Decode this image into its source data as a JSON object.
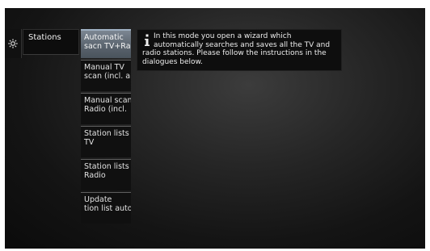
{
  "menu": {
    "category": "Stations"
  },
  "submenu": {
    "items": [
      {
        "label_line1": "Automatic",
        "label_line2": "sacn TV+Rad"
      },
      {
        "label_line1": "Manual TV",
        "label_line2": "scan (incl. an"
      },
      {
        "label_line1": "Manual scan",
        "label_line2": "Radio (incl."
      },
      {
        "label_line1": "Station lists",
        "label_line2": "TV"
      },
      {
        "label_line1": "Station lists",
        "label_line2": "Radio"
      },
      {
        "label_line1": "Update",
        "label_line2": "tion list auto"
      }
    ]
  },
  "info": {
    "text": "In this mode you open a wizard which automatically searches and saves all the TV and radio stations. Please follow the instructions in the dialogues below."
  },
  "icons": {
    "settings": "gear-icon",
    "info": "info-icon"
  },
  "colors": {
    "active_item": "#5f6a75",
    "background": "#1a1a1a"
  }
}
